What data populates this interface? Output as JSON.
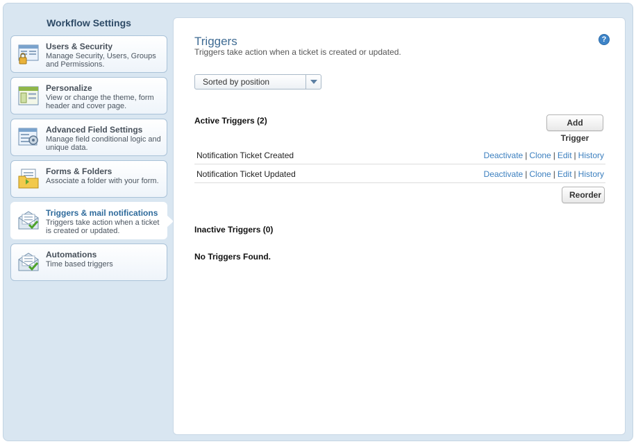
{
  "sidebar": {
    "title": "Workflow Settings",
    "items": [
      {
        "label": "Users & Security",
        "desc": "Manage Security, Users, Groups and Permissions.",
        "icon": "users-security-icon"
      },
      {
        "label": "Personalize",
        "desc": "View or change the theme, form header and cover page.",
        "icon": "personalize-icon"
      },
      {
        "label": "Advanced Field Settings",
        "desc": "Manage field conditional logic and unique data.",
        "icon": "field-settings-icon"
      },
      {
        "label": "Forms & Folders",
        "desc": "Associate a folder with your form.",
        "icon": "folder-icon"
      },
      {
        "label": "Triggers & mail notifications",
        "desc": "Triggers take action when a ticket is created or updated.",
        "icon": "mail-trigger-icon",
        "active": true
      },
      {
        "label": "Automations",
        "desc": "Time based triggers",
        "icon": "automation-icon"
      }
    ]
  },
  "main": {
    "title": "Triggers",
    "subtitle": "Triggers take action when a ticket is created or updated.",
    "help_icon": "question-mark-icon",
    "sort": {
      "selected": "Sorted by position"
    },
    "active_heading": "Active Triggers (2)",
    "add_button": "Add Trigger",
    "actions": {
      "deactivate": "Deactivate",
      "clone": "Clone",
      "edit": "Edit",
      "history": "History",
      "separator": "|"
    },
    "triggers": [
      {
        "name": "Notification Ticket Created"
      },
      {
        "name": "Notification Ticket Updated"
      }
    ],
    "reorder_button": "Reorder",
    "inactive_heading": "Inactive Triggers (0)",
    "empty_text": "No Triggers Found."
  },
  "colors": {
    "accent": "#3b7fbf",
    "title": "#3f6b93",
    "sidebar_bg": "#d9e6f1"
  }
}
